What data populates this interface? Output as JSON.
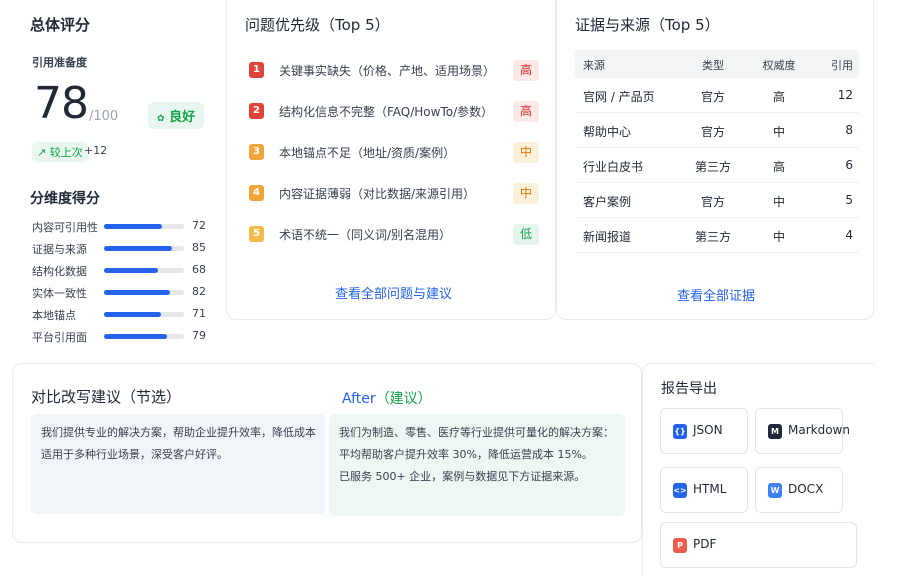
{
  "overall": {
    "title": "总体评分",
    "readiness_label": "引用准备度",
    "score": "78",
    "score_max": "/100",
    "rating": "良好",
    "rating_icon": "leaf-icon",
    "delta_label": "较上次",
    "delta_value": "+12",
    "dimensions_title": "分维度得分",
    "dimensions": [
      {
        "label": "内容可引用性",
        "value": 72
      },
      {
        "label": "证据与来源",
        "value": 85
      },
      {
        "label": "结构化数据",
        "value": 68
      },
      {
        "label": "实体一致性",
        "value": 82
      },
      {
        "label": "本地锚点",
        "value": 71
      },
      {
        "label": "平台引用面",
        "value": 79
      }
    ]
  },
  "issues": {
    "title": "问题优先级（Top 5）",
    "items": [
      {
        "num": "1",
        "text": "关键事实缺失（价格、产地、适用场景）",
        "level": "高",
        "color": "#e0453a"
      },
      {
        "num": "2",
        "text": "结构化信息不完整（FAQ/HowTo/参数）",
        "level": "高",
        "color": "#e0453a"
      },
      {
        "num": "3",
        "text": "本地锚点不足（地址/资质/案例）",
        "level": "中",
        "color": "#f0a63a"
      },
      {
        "num": "4",
        "text": "内容证据薄弱（对比数据/来源引用）",
        "level": "中",
        "color": "#f0a63a"
      },
      {
        "num": "5",
        "text": "术语不统一（同义词/别名混用）",
        "level": "低",
        "color": "#f5b94c"
      }
    ],
    "link": "查看全部问题与建议"
  },
  "evidence": {
    "title": "证据与来源（Top 5）",
    "headers": {
      "source": "来源",
      "type": "类型",
      "authority": "权威度",
      "refs": "引用"
    },
    "rows": [
      {
        "source": "官网 / 产品页",
        "type": "官方",
        "authority": "高",
        "refs": "12"
      },
      {
        "source": "帮助中心",
        "type": "官方",
        "authority": "中",
        "refs": "8"
      },
      {
        "source": "行业白皮书",
        "type": "第三方",
        "authority": "高",
        "refs": "6"
      },
      {
        "source": "客户案例",
        "type": "官方",
        "authority": "中",
        "refs": "5"
      },
      {
        "source": "新闻报道",
        "type": "第三方",
        "authority": "中",
        "refs": "4"
      }
    ],
    "link": "查看全部证据"
  },
  "rewrite": {
    "title": "对比改写建议（节选）",
    "after_title": "After",
    "after_suffix": "（建议）",
    "before_lines": [
      "我们提供专业的解决方案，帮助企业提升效率，降低成本",
      "适用于多种行业场景，深受客户好评。"
    ],
    "after_lines": [
      "我们为制造、零售、医疗等行业提供可量化的解决方案：",
      "平均帮助客户提升效率 30%，降低运营成本 15%。",
      "已服务 500+ 企业，案例与数据见下方证据来源。"
    ]
  },
  "export": {
    "title": "报告导出",
    "buttons": [
      {
        "label": "JSON",
        "icon": "json-file-icon",
        "glyph": "{}",
        "color": "#2563eb"
      },
      {
        "label": "Markdown",
        "icon": "markdown-file-icon",
        "glyph": "M",
        "color": "#1f2937"
      },
      {
        "label": "HTML",
        "icon": "html-file-icon",
        "glyph": "<>",
        "color": "#2563eb"
      },
      {
        "label": "DOCX",
        "icon": "docx-file-icon",
        "glyph": "W",
        "color": "#3b82f6"
      },
      {
        "label": "PDF",
        "icon": "pdf-file-icon",
        "glyph": "P",
        "color": "#ef5b4c"
      }
    ]
  }
}
